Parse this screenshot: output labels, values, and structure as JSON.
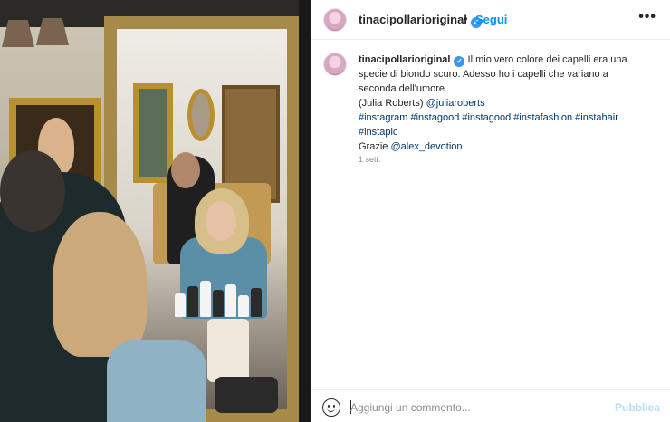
{
  "post": {
    "username": "tinacipollarioriginal",
    "verified_icon": "verified-badge-icon",
    "separator": "•",
    "follow_label": "Segui",
    "more_label": "•••"
  },
  "caption": {
    "username": "tinacipollarioriginal",
    "text_line1": "Il mio vero colore dei capelli era una",
    "text_line2": "specie di biondo scuro. Adesso ho i capelli che variano a",
    "text_line3": "seconda dell'umore.",
    "paren": "(Julia Roberts)",
    "mention1": "@juliaroberts",
    "hashtags_line1": [
      "#instagram",
      "#instagood",
      "#instagood",
      "#instafashion",
      "#instahair"
    ],
    "hashtags_line2": [
      "#instapic"
    ],
    "thanks": "Grazie",
    "mention2": "@alex_devotion"
  },
  "timestamp": "1 sett.",
  "comment": {
    "placeholder": "Aggiungi un commento...",
    "value": "",
    "publish_label": "Pubblica",
    "emoji_icon": "emoji-icon"
  },
  "colors": {
    "accent": "#0095f6",
    "link": "#00376b",
    "publish_disabled": "#b2dffc",
    "muted": "#8e8e8e"
  }
}
